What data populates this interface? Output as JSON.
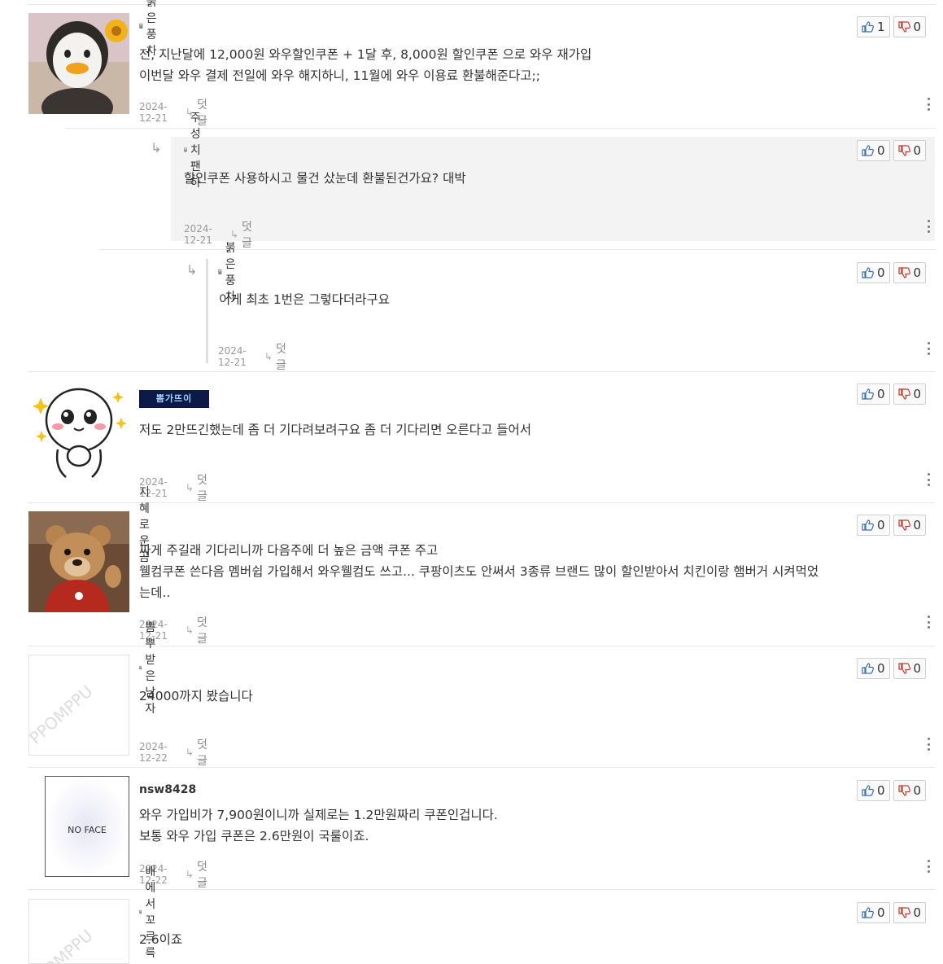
{
  "comments": [
    {
      "nickname": "붉은풍차",
      "lines": [
        "전, 지난달에 12,000원 와우할인쿠폰 + 1달 후, 8,000원 할인쿠폰 으로 와우 재가입",
        "이번달 와우 결제 전일에 와우 해지하니, 11월에 와우 이용료 환불해준다고;;"
      ],
      "date": "2024-12-21",
      "reply_label": "덧글",
      "up": "1",
      "down": "0",
      "avatar_icon": "penguin-avatar-icon"
    },
    {
      "nickname": "주성치팬하",
      "lines": [
        "할인쿠폰 사용하시고 물건 샀눈데 환불된건가요? 대박"
      ],
      "date": "2024-12-21",
      "reply_label": "덧글",
      "up": "0",
      "down": "0"
    },
    {
      "nickname": "붉은풍차",
      "lines": [
        "이게 최초 1번은 그렇다더라구요"
      ],
      "date": "2024-12-21",
      "reply_label": "덧글",
      "up": "0",
      "down": "0"
    },
    {
      "nickname": "",
      "nickname_badge": "뽐가뜨이",
      "lines": [
        "저도 2만뜨긴했는데 좀 더 기다려보려구요 좀 더 기다리면 오른다고 들어서"
      ],
      "date": "2024-12-21",
      "reply_label": "덧글",
      "up": "0",
      "down": "0",
      "avatar_icon": "pleading-emoji-avatar-icon"
    },
    {
      "nickname": "지혜로운곰",
      "lines": [
        "짜게 주길래 기다리니까 다음주에 더 높은 금액 쿠폰 주고",
        "웰컴쿠폰 쓴다음 멤버쉽 가입해서 와우웰컴도 쓰고... 쿠팡이츠도 안써서 3종류 브랜드 많이 할인받아서 치킨이랑 햄버거 시켜먹었",
        "는데.."
      ],
      "date": "2024-12-21",
      "reply_label": "덧글",
      "up": "0",
      "down": "0",
      "avatar_icon": "teddy-bear-avatar-icon"
    },
    {
      "nickname": "뽐뿌받은남자",
      "lines": [
        "24000까지 봤습니다"
      ],
      "date": "2024-12-22",
      "reply_label": "덧글",
      "up": "0",
      "down": "0",
      "avatar_text": "PPOMPPU"
    },
    {
      "nickname": "nsw8428",
      "lines": [
        "와우 가입비가 7,900원이니까 실제로는 1.2만원짜리 쿠폰인겁니다.",
        "보통 와우 가입 쿠폰은 2.6만원이 국룰이죠."
      ],
      "date": "2024-12-22",
      "reply_label": "덧글",
      "up": "0",
      "down": "0",
      "avatar_text": "NO FACE"
    },
    {
      "nickname": "배에서꼬르륵",
      "lines": [
        "2.6이죠"
      ],
      "date": "",
      "reply_label": "",
      "up": "0",
      "down": "0",
      "avatar_text": "PPOMPPU"
    }
  ]
}
